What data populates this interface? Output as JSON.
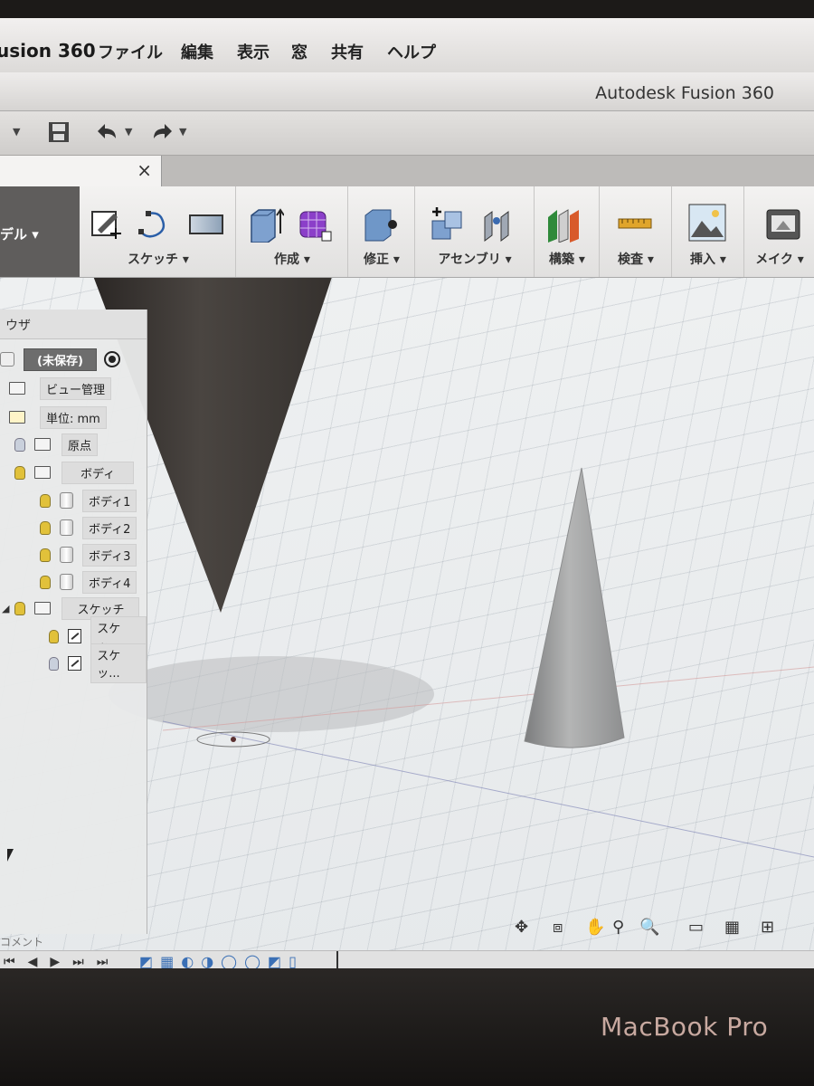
{
  "app": {
    "menu_app_name": "usion 360",
    "menu_items": [
      "ファイル",
      "編集",
      "表示",
      "窓",
      "共有",
      "ヘルプ"
    ],
    "window_title": "Autodesk Fusion 360"
  },
  "toolbar": {
    "workspace_label": "デル ▾",
    "groups": [
      {
        "label": "スケッチ ▾"
      },
      {
        "label": "作成 ▾"
      },
      {
        "label": "修正 ▾"
      },
      {
        "label": "アセンブリ ▾"
      },
      {
        "label": "構築 ▾"
      },
      {
        "label": "検査 ▾"
      },
      {
        "label": "挿入 ▾"
      },
      {
        "label": "メイク ▾"
      }
    ]
  },
  "tab": {
    "close_glyph": "×"
  },
  "browser": {
    "header": "ウザ",
    "root_label": "(未保存)",
    "items": [
      {
        "label": "ビュー管理"
      },
      {
        "label": "単位: mm"
      },
      {
        "label": "原点"
      },
      {
        "label": "ボディ"
      },
      {
        "label": "ボディ1"
      },
      {
        "label": "ボディ2"
      },
      {
        "label": "ボディ3"
      },
      {
        "label": "ボディ4"
      },
      {
        "label": "スケッチ"
      },
      {
        "label": "スケッ..."
      },
      {
        "label": "スケッ..."
      }
    ]
  },
  "comment_label": "コメント",
  "device_logo": "MacBook Pro",
  "icons": [
    "save-icon",
    "undo-icon",
    "redo-icon",
    "close-icon",
    "orbit-icon",
    "pan-icon",
    "zoom-icon",
    "display-icon",
    "grid-icon"
  ]
}
